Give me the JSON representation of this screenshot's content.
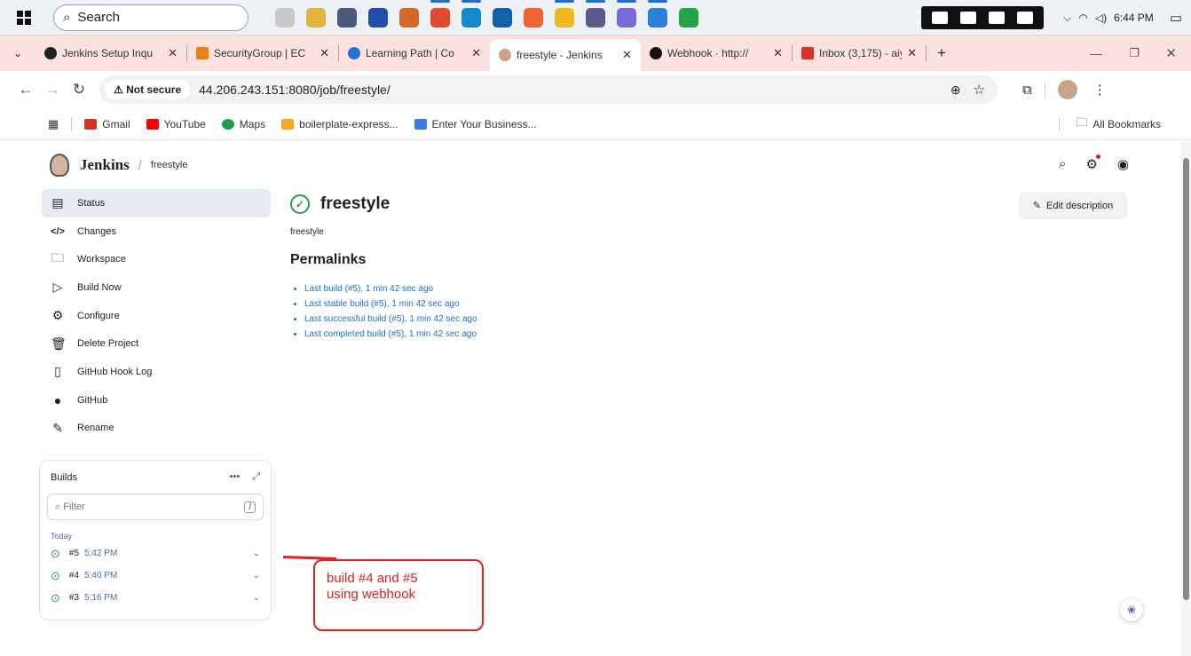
{
  "taskbar": {
    "search_placeholder": "Search",
    "time": "6:44 PM"
  },
  "tabs": [
    {
      "title": "Jenkins Setup Inqu",
      "fav_color": "#222222"
    },
    {
      "title": "SecurityGroup | EC",
      "fav_color": "#e8821b"
    },
    {
      "title": "Learning Path | Co",
      "fav_color": "#2d6cdf"
    },
    {
      "title": "freestyle - Jenkins",
      "fav_color": "#c9a489",
      "active": true
    },
    {
      "title": "Webhook · http://",
      "fav_color": "#111111"
    },
    {
      "title": "Inbox (3,175) - aiy",
      "fav_color": "#d93025"
    }
  ],
  "address": {
    "security_label": "Not secure",
    "url": "44.206.243.151:8080/job/freestyle/"
  },
  "bookmarks": [
    {
      "label": "Gmail",
      "color": "#d93025"
    },
    {
      "label": "YouTube",
      "color": "#ff0000"
    },
    {
      "label": "Maps",
      "color": "#1a9e4b"
    },
    {
      "label": "boilerplate-express...",
      "color": "#f5a623"
    },
    {
      "label": "Enter Your Business...",
      "color": "#3b7be8"
    }
  ],
  "bookmarks_all": "All Bookmarks",
  "jenkins": {
    "brand": "Jenkins",
    "breadcrumb": "freestyle"
  },
  "sidebar": [
    {
      "label": "Status",
      "icon": "document-icon",
      "glyph": "▤",
      "selected": true
    },
    {
      "label": "Changes",
      "icon": "code-icon",
      "glyph": "</>"
    },
    {
      "label": "Workspace",
      "icon": "folder-icon",
      "glyph": "🗀"
    },
    {
      "label": "Build Now",
      "icon": "play-icon",
      "glyph": "▷"
    },
    {
      "label": "Configure",
      "icon": "gear-icon",
      "glyph": "⚙"
    },
    {
      "label": "Delete Project",
      "icon": "trash-icon",
      "glyph": "🗑"
    },
    {
      "label": "GitHub Hook Log",
      "icon": "clipboard-icon",
      "glyph": "▯"
    },
    {
      "label": "GitHub",
      "icon": "github-icon",
      "glyph": "●"
    },
    {
      "label": "Rename",
      "icon": "pencil-icon",
      "glyph": "✎"
    }
  ],
  "builds": {
    "title": "Builds",
    "filter_placeholder": "Filter",
    "filter_shortcut": "/",
    "group": "Today",
    "items": [
      {
        "number": "#5",
        "time": "5:42 PM"
      },
      {
        "number": "#4",
        "time": "5:40 PM"
      },
      {
        "number": "#3",
        "time": "5:16 PM"
      }
    ]
  },
  "main": {
    "title": "freestyle",
    "description": "freestyle",
    "edit_label": "Edit description",
    "permalinks_heading": "Permalinks",
    "permalinks": [
      "Last build (#5), 1 min 42 sec ago",
      "Last stable build (#5), 1 min 42 sec ago",
      "Last successful build (#5), 1 min 42 sec ago",
      "Last completed build (#5), 1 min 42 sec ago"
    ]
  },
  "annotation": {
    "line1": "build #4 and #5",
    "line2": "using webhook",
    "color": "#e02020"
  }
}
